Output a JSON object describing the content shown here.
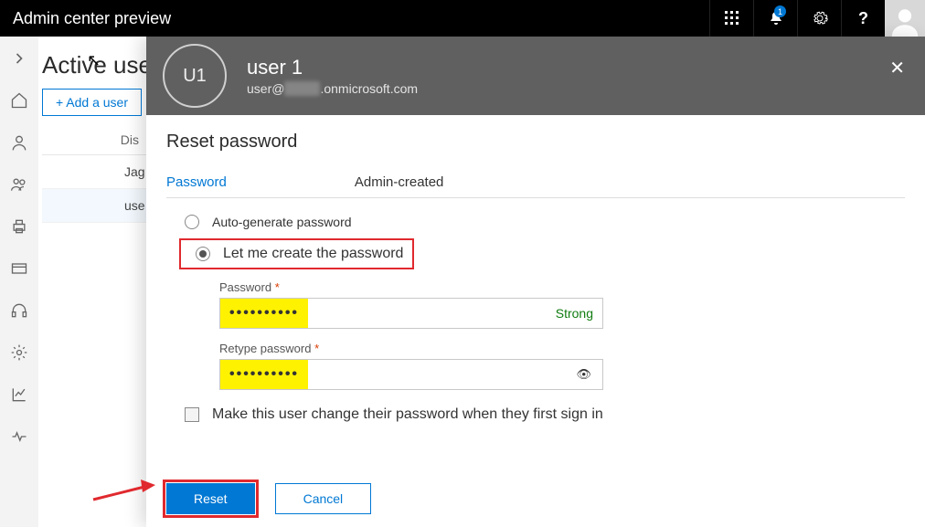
{
  "topbar": {
    "title": "Admin center preview",
    "notification_badge": "1"
  },
  "page": {
    "heading": "Active users",
    "add_user_label": "+ Add a user",
    "col_display": "Dis",
    "rows": [
      "Jag",
      "use"
    ]
  },
  "panel": {
    "avatar_initials": "U1",
    "user_name": "user 1",
    "user_email_prefix": "user@",
    "user_email_blur": "xxxxx",
    "user_email_suffix": ".onmicrosoft.com",
    "title": "Reset password",
    "tab_password": "Password",
    "tab_method": "Admin-created",
    "opt_auto": "Auto-generate password",
    "opt_manual": "Let me create the password",
    "field_password_label": "Password",
    "required_mark": "*",
    "password_dots": "••••••••••",
    "strength_label": "Strong",
    "field_retype_label": "Retype password",
    "retype_dots": "••••••••••",
    "change_first_signin": "Make this user change their password when they first sign in",
    "btn_reset": "Reset",
    "btn_cancel": "Cancel"
  }
}
